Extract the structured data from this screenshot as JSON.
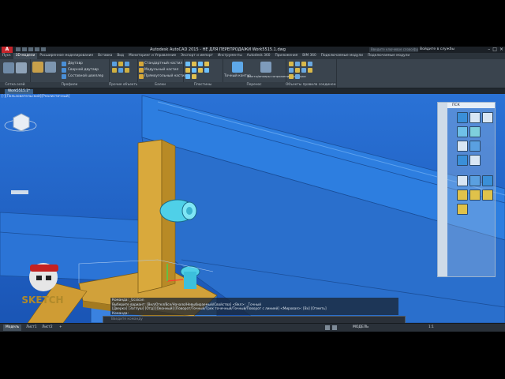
{
  "window": {
    "title": "Autodesk AutoCAD 2015 - НЕ ДЛЯ ПЕРЕПРОДАЖИ    Work5515.1.dwg",
    "search_placeholder": "Введите ключевое слово/фразу",
    "user": "Войдите в службы"
  },
  "tabs": [
    {
      "label": "Пуск"
    },
    {
      "label": "3D-модели"
    },
    {
      "label": "Расширенное моделирование"
    },
    {
      "label": "Вставка"
    },
    {
      "label": "Вид"
    },
    {
      "label": "Мониторинг и Управление"
    },
    {
      "label": "Экспорт и импорт"
    },
    {
      "label": "Инструменты"
    },
    {
      "label": "Autodesk 360"
    },
    {
      "label": "Приложения"
    },
    {
      "label": "BIM 360"
    },
    {
      "label": "Подключаемые модули"
    },
    {
      "label": "Подключаемые модули"
    }
  ],
  "ribbon": {
    "panels": [
      {
        "title": "Сетка осей"
      },
      {
        "title": "Профили"
      },
      {
        "title": "Прочие объекты"
      },
      {
        "title": "Пластины"
      },
      {
        "title": "Балки"
      },
      {
        "title": "Пластины"
      },
      {
        "title": "Перенос"
      },
      {
        "title": "Объекты правила соединения"
      }
    ],
    "commands": {
      "beam1": "Двутавр",
      "beam2": "Сварной двутавр",
      "beam3": "Составной швеллер",
      "plate1": "Стандартный настил",
      "plate2": "Модульный настил",
      "plate3": "Прямоугольный настил",
      "view_btn": "Точный контур",
      "conn_btn": "Болты/анкеры сопряжения/шпильки"
    }
  },
  "filetab": "Work5515.1*",
  "viewport_label": "[-][Пользовательский][Реалистичный]",
  "palette": {
    "title": "ПСК"
  },
  "command_history": [
    "Команда: _Ucsicon",
    "Выберите вариант: [Вкл/Откл/Все/Начало/Невыбираемый/Свойства] <Вкл>: _Точный",
    "[Дверка] [Заглуш] [Отд] [Оконный] [Поворот/Точный/Трех точечный/Точный/Поворот с линией] <Мировая>: [Вх] [Отметь]",
    "Команда:"
  ],
  "command_input_placeholder": "Введите команду",
  "status": {
    "tabs": [
      {
        "label": "Модель"
      },
      {
        "label": "Лист1"
      },
      {
        "label": "Лист2"
      }
    ],
    "mode": "МОДЕЛЬ",
    "scale": "1:1"
  },
  "watermark": "SKETCH"
}
